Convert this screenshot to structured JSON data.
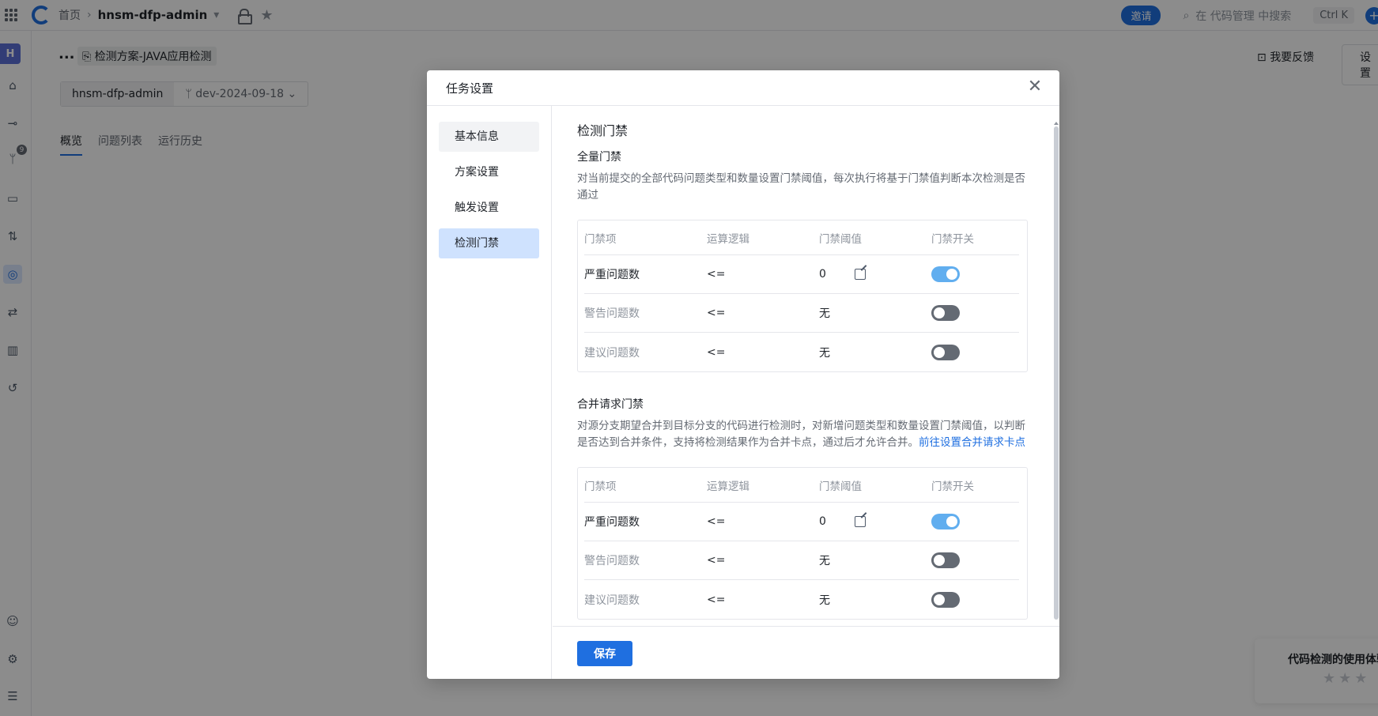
{
  "topbar": {
    "home": "首页",
    "project": "hnsm-dfp-admin",
    "invite": "邀请",
    "search_placeholder": "在 代码管理 中搜索",
    "shortcut": "Ctrl K"
  },
  "sidebar": {
    "avatar_letter": "H",
    "branch_badge": "9"
  },
  "page": {
    "ellipsis": "...",
    "plan_title": "检测方案-JAVA应用检测",
    "repo": "hnsm-dfp-admin",
    "branch": "dev-2024-09-18",
    "tabs": [
      "概览",
      "问题列表",
      "运行历史"
    ],
    "feedback": "我要反馈",
    "settings": "设置",
    "survey_title": "代码检测的使用体验"
  },
  "modal": {
    "title": "任务设置",
    "nav": [
      "基本信息",
      "方案设置",
      "触发设置",
      "检测门禁"
    ],
    "section_title": "检测门禁",
    "full_gate": {
      "title": "全量门禁",
      "desc": "对当前提交的全部代码问题类型和数量设置门禁阈值，每次执行将基于门禁值判断本次检测是否通过"
    },
    "merge_gate": {
      "title": "合并请求门禁",
      "desc": "对源分支期望合并到目标分支的代码进行检测时，对新增问题类型和数量设置门禁阈值，以判断是否达到合并条件，支持将检测结果作为合并卡点，通过后才允许合并。",
      "link": "前往设置合并请求卡点"
    },
    "columns": [
      "门禁项",
      "运算逻辑",
      "门禁阈值",
      "门禁开关"
    ],
    "full_rows": [
      {
        "item": "严重问题数",
        "op": "<=",
        "threshold": "0",
        "enabled": true
      },
      {
        "item": "警告问题数",
        "op": "<=",
        "threshold": "无",
        "enabled": false
      },
      {
        "item": "建议问题数",
        "op": "<=",
        "threshold": "无",
        "enabled": false
      }
    ],
    "merge_rows": [
      {
        "item": "严重问题数",
        "op": "<=",
        "threshold": "0",
        "enabled": true
      },
      {
        "item": "警告问题数",
        "op": "<=",
        "threshold": "无",
        "enabled": false
      },
      {
        "item": "建议问题数",
        "op": "<=",
        "threshold": "无",
        "enabled": false
      }
    ],
    "save": "保存",
    "close_symbol": "✕"
  }
}
